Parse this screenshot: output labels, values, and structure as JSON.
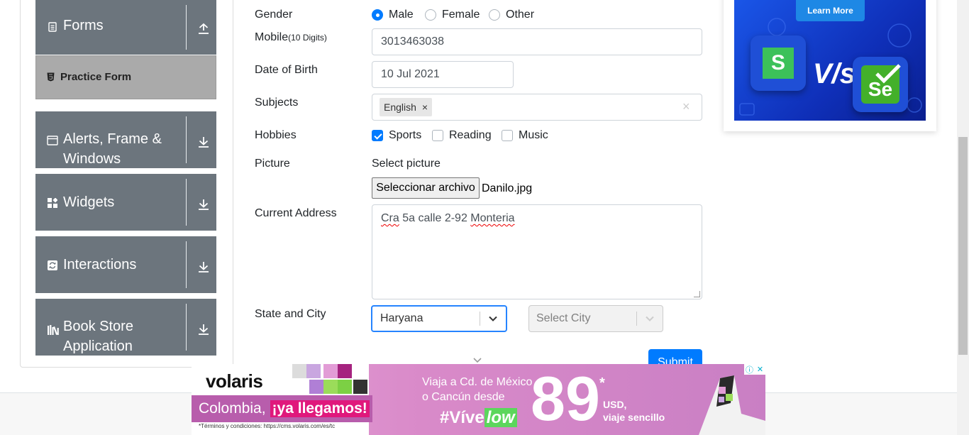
{
  "sidebar": {
    "groups": [
      {
        "title": "Forms",
        "icon": "document-icon",
        "arrow": "up"
      },
      {
        "title": "Alerts, Frame & Windows",
        "icon": "window-icon",
        "arrow": "down"
      },
      {
        "title": "Widgets",
        "icon": "widgets-icon",
        "arrow": "down"
      },
      {
        "title": "Interactions",
        "icon": "interactions-icon",
        "arrow": "down"
      },
      {
        "title": "Book Store Application",
        "icon": "books-icon",
        "arrow": "down"
      }
    ],
    "active_item": {
      "label": "Practice Form",
      "icon": "html5-icon"
    }
  },
  "form": {
    "gender": {
      "label": "Gender",
      "options": [
        "Male",
        "Female",
        "Other"
      ],
      "selected": "Male"
    },
    "mobile": {
      "label": "Mobile",
      "hint": "(10 Digits)",
      "value": "3013463038"
    },
    "dob": {
      "label": "Date of Birth",
      "value": "10 Jul 2021"
    },
    "subjects": {
      "label": "Subjects",
      "tags": [
        "English"
      ],
      "remove_glyph": "×",
      "clear_glyph": "×"
    },
    "hobbies": {
      "label": "Hobbies",
      "options": [
        "Sports",
        "Reading",
        "Music"
      ],
      "checked": [
        "Sports"
      ]
    },
    "picture": {
      "label": "Picture",
      "select_text": "Select picture",
      "button_label": "Seleccionar archivo",
      "file_name": "Danilo.jpg"
    },
    "address": {
      "label": "Current Address",
      "value_prefix": "Cra",
      "value_mid": " 5a calle 2-92 ",
      "value_suffix": "Monteria"
    },
    "state_city": {
      "label": "State and City",
      "state_value": "Haryana",
      "city_placeholder": "Select City"
    },
    "submit_label": "Submit"
  },
  "ad_right": {
    "button_label": "Learn More",
    "vs_text": "V/s",
    "left_logo_letter": "S",
    "right_logo_text": "Se"
  },
  "ad_bottom": {
    "brand": "volaris",
    "headline_prefix": "Colombia,",
    "headline_highlight": "¡ya llegamos!",
    "terms": "*Términos y condiciones: https://cms.volaris.com/es/tc",
    "offer_line1": "Viaja a Cd. de México",
    "offer_line2": "o Cancún desde",
    "hashtag_prefix": "#Víve",
    "hashtag_highlight": "low",
    "price": "89",
    "price_mark": "*",
    "currency": "USD,",
    "trip_line1": "viaje sencillo",
    "info_glyph": "ⓘ",
    "close_glyph": "✕"
  },
  "colors": {
    "primary": "#007bff",
    "sidebar_group": "#6c757d",
    "practice_active": "#aaaaaa",
    "ad_blue": "#1a56e8",
    "volaris_pink": "#d98ac9",
    "volaris_green": "#5cd65c",
    "selenium_green": "#43b02a"
  }
}
